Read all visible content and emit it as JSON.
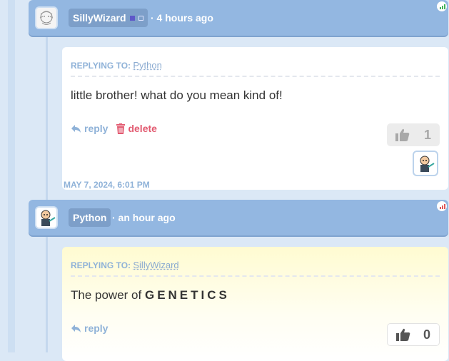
{
  "comments": [
    {
      "author": "SillyWizard",
      "time": "· 4 hours ago",
      "replying_label": "REPLYING TO:",
      "replying_to": "Python",
      "text": "little brother! what do you mean kind of!",
      "reply_label": "reply",
      "delete_label": "delete",
      "likes": "1",
      "date": "MAY 7, 2024, 6:01 PM"
    },
    {
      "author": "Python",
      "time": "· an hour ago",
      "replying_label": "REPLYING TO:",
      "replying_to": "SillyWizard",
      "text_prefix": "The power of",
      "text_emphasis": "GENETICS",
      "reply_label": "reply",
      "likes": "0"
    }
  ],
  "colors": {
    "header": "#93b7e1",
    "accent": "#8fb2d8",
    "delete": "#e25a70",
    "signal_green": "#44b35a",
    "signal_red": "#e05a5a"
  }
}
